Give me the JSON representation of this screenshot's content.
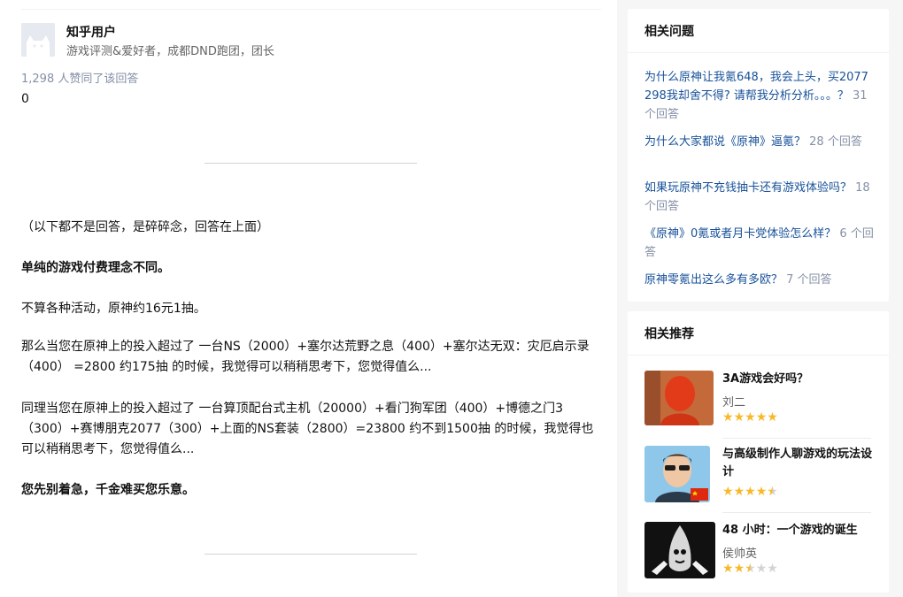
{
  "answer": {
    "author_name": "知乎用户",
    "author_bio": "游戏评测&爱好者，成都DND跑团，团长",
    "votes": "1,298 人赞同了该回答",
    "zero": "0",
    "paragraphs": [
      "（以下都不是回答，是碎碎念，回答在上面）",
      "单纯的游戏付费理念不同。",
      "不算各种活动，原神约16元1抽。",
      "那么当您在原神上的投入超过了 一台NS（2000）+塞尔达荒野之息（400）+塞尔达无双：灾厄启示录（400） =2800 约175抽 的时候，我觉得可以稍稍思考下，您觉得值么...",
      "同理当您在原神上的投入超过了 一台算顶配台式主机（20000）+看门狗军团（400）+博德之门3（300）+赛博朋克2077（300）+上面的NS套装（2800）=23800 约不到1500抽 的时候，我觉得也可以稍稍思考下，您觉得值么...",
      "您先别着急，千金难买您乐意。"
    ]
  },
  "related_questions": {
    "title": "相关问题",
    "items": [
      {
        "text": "为什么原神让我氪648，我会上头，买2077 298我却舍不得? 请帮我分析分析。。。？",
        "count": "31 个回答"
      },
      {
        "text": "为什么大家都说《原神》逼氪？",
        "count": "28 个回答"
      },
      {
        "text": "如果玩原神不充钱抽卡还有游戏体验吗？",
        "count": "18 个回答"
      },
      {
        "text": "《原神》0氪或者月卡党体验怎么样？",
        "count": "6 个回答"
      },
      {
        "text": "原神零氪出这么多有多欧？",
        "count": "7 个回答"
      }
    ]
  },
  "recommendations": {
    "title": "相关推荐",
    "items": [
      {
        "title": "3A游戏会好吗？",
        "author": "刘二",
        "rating": 5.0
      },
      {
        "title": "与高级制作人聊游戏的玩法设计",
        "author": "",
        "rating": 4.5
      },
      {
        "title": "48 小时：一个游戏的诞生",
        "author": "侯帅英",
        "rating": 2.5
      }
    ]
  },
  "colors": {
    "link": "#175199",
    "muted": "#8590a6",
    "star": "#f7b928"
  }
}
